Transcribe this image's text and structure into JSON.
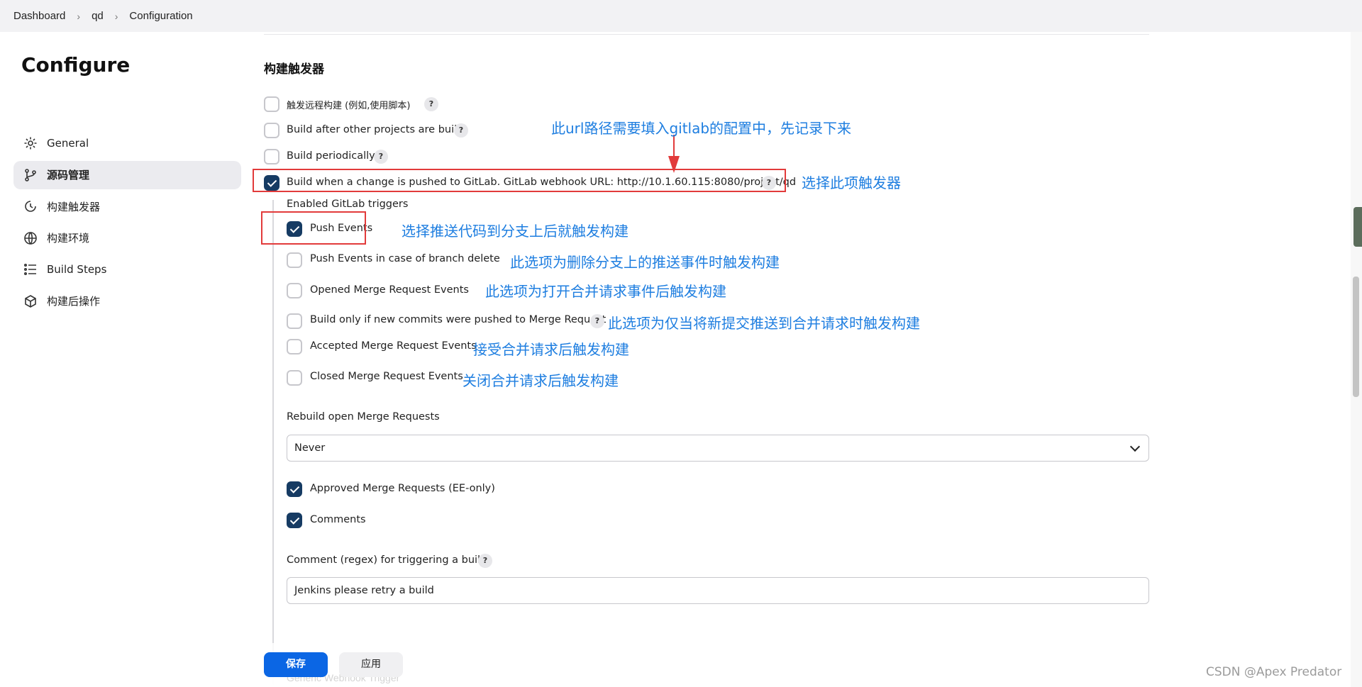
{
  "breadcrumb": {
    "items": [
      "Dashboard",
      "qd",
      "Configuration"
    ]
  },
  "sidebar": {
    "title": "Configure",
    "items": [
      {
        "label": "General",
        "icon": "gear-icon"
      },
      {
        "label": "源码管理",
        "icon": "branch-icon"
      },
      {
        "label": "构建触发器",
        "icon": "clock-icon"
      },
      {
        "label": "构建环境",
        "icon": "globe-icon"
      },
      {
        "label": "Build Steps",
        "icon": "list-icon"
      },
      {
        "label": "构建后操作",
        "icon": "cube-icon"
      }
    ]
  },
  "main": {
    "section_title": "构建触发器",
    "triggers": [
      {
        "label": "触发远程构建 (例如,使用脚本)",
        "checked": false
      },
      {
        "label": "Build after other projects are built",
        "checked": false
      },
      {
        "label": "Build periodically",
        "checked": false
      },
      {
        "label": "Build when a change is pushed to GitLab. GitLab webhook URL: http://10.1.60.115:8080/project/qd",
        "checked": true
      }
    ],
    "gitlab": {
      "heading": "Enabled GitLab triggers",
      "options": [
        {
          "label": "Push Events",
          "checked": true
        },
        {
          "label": "Push Events in case of branch delete",
          "checked": false
        },
        {
          "label": "Opened Merge Request Events",
          "checked": false
        },
        {
          "label": "Build only if new commits were pushed to Merge Request",
          "checked": false
        },
        {
          "label": "Accepted Merge Request Events",
          "checked": false
        },
        {
          "label": "Closed Merge Request Events",
          "checked": false
        }
      ],
      "rebuild_label": "Rebuild open Merge Requests",
      "rebuild_value": "Never",
      "approved_label": "Approved Merge Requests (EE-only)",
      "approved_checked": true,
      "comments_label": "Comments",
      "comments_checked": true,
      "regex_label": "Comment (regex) for triggering a build",
      "regex_value": "Jenkins please retry a build"
    },
    "help_glyph": "?"
  },
  "footer": {
    "save_label": "保存",
    "apply_label": "应用",
    "obscured_label": "Generic Webhook Trigger"
  },
  "annotations": {
    "url_note": "此url路径需要填入gitlab的配置中，先记录下来",
    "select_trigger": "选择此项触发器",
    "push_events": "选择推送代码到分支上后就触发构建",
    "branch_delete": "此选项为删除分支上的推送事件时触发构建",
    "opened_mr": "此选项为打开合并请求事件后触发构建",
    "new_commits_mr": "此选项为仅当将新提交推送到合并请求时触发构建",
    "accepted_mr": "接受合并请求后触发构建",
    "closed_mr": "关闭合并请求后触发构建"
  },
  "watermark": "CSDN @Apex   Predator",
  "colors": {
    "accent": "#0b66e4",
    "checkbox_checked": "#163b63",
    "annotation": "#1e7ee0",
    "highlight_box": "#e23b3b"
  }
}
